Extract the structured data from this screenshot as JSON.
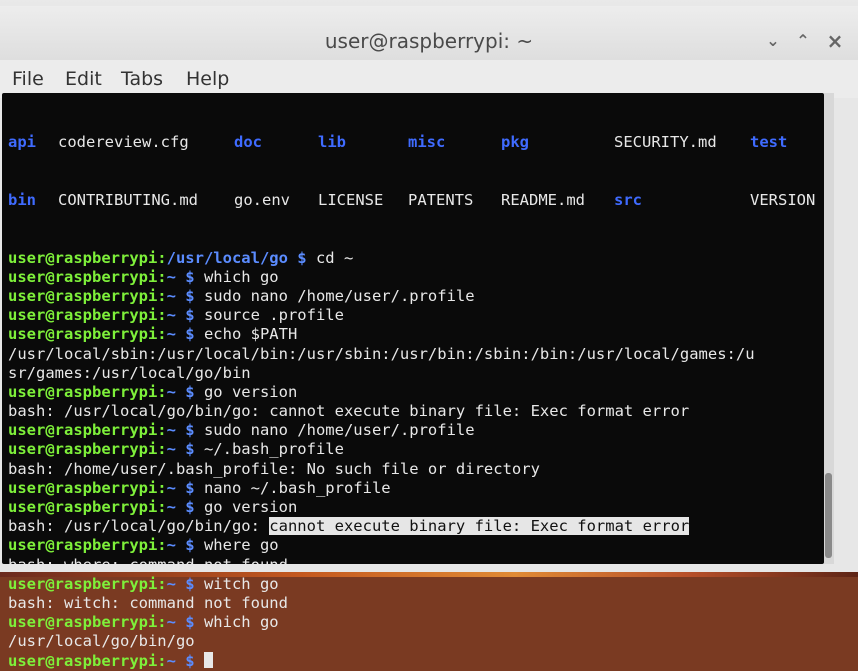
{
  "window": {
    "title": "user@raspberrypi: ~",
    "minimize": "⌄",
    "maximize": "⌃",
    "close": "×"
  },
  "menu": {
    "file": "File",
    "edit": "Edit",
    "tabs": "Tabs",
    "help": "Help"
  },
  "ls": {
    "row1": [
      {
        "text": "api",
        "dir": true
      },
      {
        "text": "codereview.cfg",
        "dir": false
      },
      {
        "text": "doc",
        "dir": true
      },
      {
        "text": "lib",
        "dir": true
      },
      {
        "text": "misc",
        "dir": true
      },
      {
        "text": "pkg",
        "dir": true
      },
      {
        "text": "SECURITY.md",
        "dir": false
      },
      {
        "text": "test",
        "dir": true
      }
    ],
    "row2": [
      {
        "text": "bin",
        "dir": true
      },
      {
        "text": "CONTRIBUTING.md",
        "dir": false
      },
      {
        "text": "go.env",
        "dir": false
      },
      {
        "text": "LICENSE",
        "dir": false
      },
      {
        "text": "PATENTS",
        "dir": false
      },
      {
        "text": "README.md",
        "dir": false
      },
      {
        "text": "src",
        "dir": true
      },
      {
        "text": "VERSION",
        "dir": false
      }
    ]
  },
  "prompt_user": "user@raspberrypi",
  "lines": [
    {
      "type": "prompt",
      "path": "/usr/local/go",
      "cmd": "cd ~"
    },
    {
      "type": "prompt",
      "path": "~",
      "cmd": "which go"
    },
    {
      "type": "prompt",
      "path": "~",
      "cmd": "sudo nano /home/user/.profile"
    },
    {
      "type": "prompt",
      "path": "~",
      "cmd": "source .profile"
    },
    {
      "type": "prompt",
      "path": "~",
      "cmd": "echo $PATH"
    },
    {
      "type": "out",
      "text": "/usr/local/sbin:/usr/local/bin:/usr/sbin:/usr/bin:/sbin:/bin:/usr/local/games:/u"
    },
    {
      "type": "out",
      "text": "sr/games:/usr/local/go/bin"
    },
    {
      "type": "prompt",
      "path": "~",
      "cmd": "go version"
    },
    {
      "type": "out",
      "text": "bash: /usr/local/go/bin/go: cannot execute binary file: Exec format error"
    },
    {
      "type": "prompt",
      "path": "~",
      "cmd": "sudo nano /home/user/.profile"
    },
    {
      "type": "prompt",
      "path": "~",
      "cmd": "~/.bash_profile"
    },
    {
      "type": "out",
      "text": "bash: /home/user/.bash_profile: No such file or directory"
    },
    {
      "type": "prompt",
      "path": "~",
      "cmd": "nano ~/.bash_profile"
    },
    {
      "type": "prompt",
      "path": "~",
      "cmd": "go version"
    },
    {
      "type": "outsel",
      "text": "bash: /usr/local/go/bin/go: ",
      "sel": "cannot execute binary file: Exec format error"
    },
    {
      "type": "prompt",
      "path": "~",
      "cmd": "where go"
    },
    {
      "type": "out",
      "text": "bash: where: command not found"
    },
    {
      "type": "prompt",
      "path": "~",
      "cmd": "witch go"
    },
    {
      "type": "out",
      "text": "bash: witch: command not found"
    },
    {
      "type": "prompt",
      "path": "~",
      "cmd": "which go"
    },
    {
      "type": "out",
      "text": "/usr/local/go/bin/go"
    },
    {
      "type": "prompt",
      "path": "~",
      "cmd": ""
    }
  ],
  "colors": {
    "user": "#7ef03a",
    "path": "#5b8cff",
    "dir": "#3f6bff",
    "bg": "#0a0a0a",
    "text": "#e8e8e8"
  }
}
